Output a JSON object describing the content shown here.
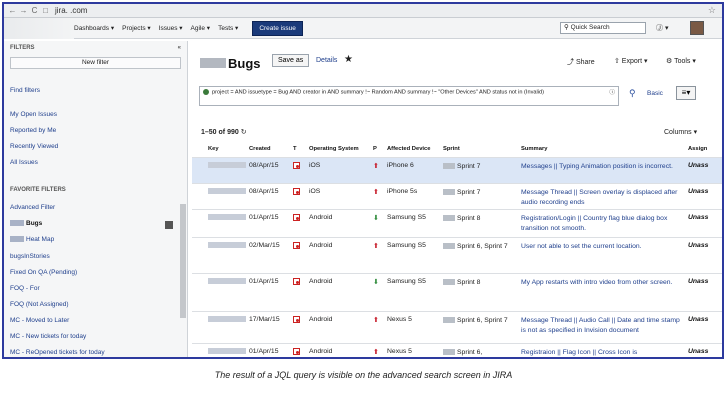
{
  "browser": {
    "url": "jira.          .com"
  },
  "header": {
    "menus": [
      "Dashboards ▾",
      "Projects ▾",
      "Issues ▾",
      "Agile ▾",
      "Tests ▾"
    ],
    "create": "Create issue",
    "search_placeholder": "Quick Search",
    "help": "Ⓙ ▾"
  },
  "sidebar": {
    "title": "FILTERS",
    "collapse": "«",
    "new_filter": "New filter",
    "find": "Find filters",
    "system": [
      "My Open Issues",
      "Reported by Me",
      "Recently Viewed",
      "All Issues"
    ],
    "fav_title": "FAVORITE FILTERS",
    "favorites": [
      "Advanced Filter",
      "Bugs",
      "Heat Map",
      "bugsInStories",
      "Fixed On QA (Pending)",
      "FOQ - For",
      "FOQ (Not Assigned)",
      "MC - Moved to Later",
      "MC - New tickets for today",
      "MC - ReOpened tickets for today"
    ]
  },
  "main": {
    "title": "Bugs",
    "save_as": "Save as",
    "details": "Details",
    "share": "⤴ Share",
    "export": "⇧ Export ▾",
    "tools": "⚙ Tools ▾",
    "jql": "project =                                   AND issuetype = Bug AND creator in                                          AND summary !~ Random AND summary !~ \"Other Devices\" AND status not in (Invalid)",
    "basic": "Basic",
    "count": "1–50 of 990",
    "columns": "Columns ▾"
  },
  "table": {
    "headers": [
      "Key",
      "Created",
      "T",
      "Operating System",
      "P",
      "Affected Device",
      "Sprint",
      "Summary",
      "Assign"
    ],
    "rows": [
      {
        "created": "08/Apr/15",
        "os": "iOS",
        "pri": "up",
        "device": "iPhone 6",
        "sprint": "Sprint 7",
        "summary": "Messages || Typing Animation position is incorrect.",
        "assignee": "Unass"
      },
      {
        "created": "08/Apr/15",
        "os": "iOS",
        "pri": "up",
        "device": "iPhone 5s",
        "sprint": "Sprint 7",
        "summary": "Message Thread || Screen overlay is displaced after audio recording ends",
        "assignee": "Unass"
      },
      {
        "created": "01/Apr/15",
        "os": "Android",
        "pri": "dn",
        "device": "Samsung S5",
        "sprint": "Sprint 8",
        "summary": "Registration/Login || Country flag blue dialog box transition not smooth.",
        "assignee": "Unass"
      },
      {
        "created": "02/Mar/15",
        "os": "Android",
        "pri": "up",
        "device": "Samsung S5",
        "sprint": "Sprint 6, Sprint 7",
        "summary": "User not able to set the current location.",
        "assignee": "Unass"
      },
      {
        "created": "01/Apr/15",
        "os": "Android",
        "pri": "dn",
        "device": "Samsung S5",
        "sprint": "Sprint 8",
        "summary": "My App restarts with intro video from other screen.",
        "assignee": "Unass"
      },
      {
        "created": "17/Mar/15",
        "os": "Android",
        "pri": "up",
        "device": "Nexus 5",
        "sprint": "Sprint 6, Sprint 7",
        "summary": "Message Thread || Audio Call || Date and time stamp is not as specified in Invision document",
        "assignee": "Unass"
      },
      {
        "created": "01/Apr/15",
        "os": "Android",
        "pri": "up",
        "device": "Nexus 5",
        "sprint": "Sprint 6,",
        "summary": "Registraion || Flag Icon || Cross Icon is",
        "assignee": "Unass"
      }
    ]
  },
  "caption": "The result of a JQL query is visible on the advanced search screen in JIRA"
}
